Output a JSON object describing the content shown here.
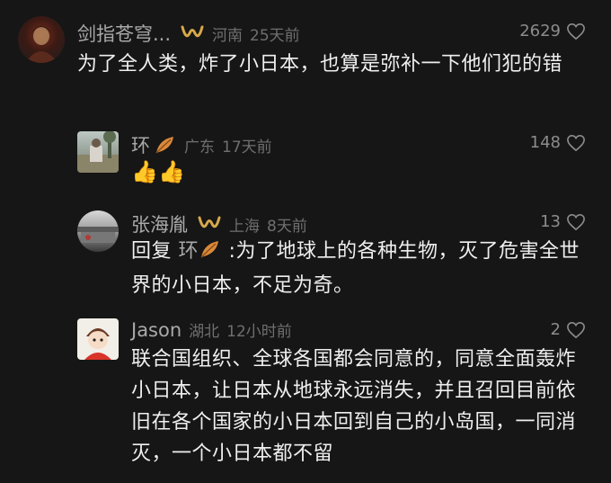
{
  "comments": [
    {
      "username": "剑指苍穹...",
      "location": "河南",
      "time": "25天前",
      "likes": "2629",
      "text": "为了全人类，炸了小日本，也算是弥补一下他们犯的错"
    },
    {
      "username": "环",
      "location": "广东",
      "time": "17天前",
      "likes": "148",
      "text": "👍👍"
    },
    {
      "username": "张海胤",
      "location": "上海",
      "time": "8天前",
      "likes": "13",
      "reply_prefix": "回复",
      "reply_target": "环",
      "text": ":为了地球上的各种生物，灭了危害全世界的小日本，不足为奇。"
    },
    {
      "username": "Jason",
      "location": "湖北",
      "time": "12小时前",
      "likes": "2",
      "text": "联合国组织、全球各国都会同意的，同意全面轰炸小日本，让日本从地球永远消失，并且召回目前依旧在各个国家的小日本回到自己的小岛国，一同消灭，一个小日本都不留"
    }
  ],
  "icons": {
    "heart": "heart-outline-icon",
    "badge_gold": "gold-wave-badge-icon",
    "badge_leaf": "autumn-leaf-icon"
  },
  "colors": {
    "background": "#161616",
    "username": "#a9a9a9",
    "meta": "#6f6f6f",
    "text": "#efefef",
    "badge_gold": "#d7a94b",
    "leaf": "#d98a3a"
  }
}
